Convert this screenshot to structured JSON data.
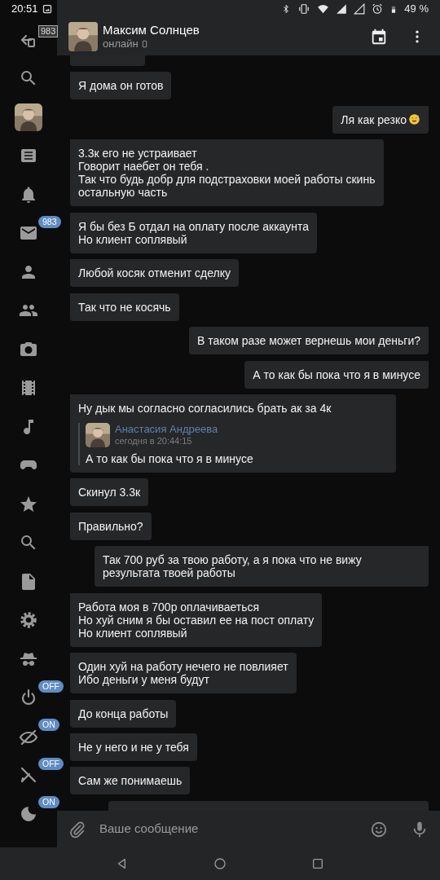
{
  "status_bar": {
    "time": "20:51",
    "battery": "49 %"
  },
  "sidebar": {
    "items": [
      {
        "kind": "back",
        "badge": {
          "text": "983",
          "kind": "box"
        }
      },
      {
        "kind": "search"
      },
      {
        "kind": "avatar"
      },
      {
        "kind": "news"
      },
      {
        "kind": "bell"
      },
      {
        "kind": "mail",
        "badge": {
          "text": "983",
          "kind": "pill"
        }
      },
      {
        "kind": "person"
      },
      {
        "kind": "people"
      },
      {
        "kind": "camera"
      },
      {
        "kind": "film"
      },
      {
        "kind": "music"
      },
      {
        "kind": "gamepad"
      },
      {
        "kind": "star"
      },
      {
        "kind": "search"
      },
      {
        "kind": "doc"
      },
      {
        "kind": "gear"
      },
      {
        "kind": "spy"
      },
      {
        "kind": "power",
        "badge": {
          "text": "OFF",
          "kind": "pill"
        }
      },
      {
        "kind": "eye",
        "badge": {
          "text": "ON",
          "kind": "pill"
        }
      },
      {
        "kind": "pen",
        "badge": {
          "text": "OFF",
          "kind": "pill"
        }
      },
      {
        "kind": "moon",
        "badge": {
          "text": "ON",
          "kind": "pill"
        }
      }
    ]
  },
  "header": {
    "name": "Максим Солнцев",
    "status": "онлайн"
  },
  "messages": [
    {
      "outgoing": false,
      "kind": "cut"
    },
    {
      "outgoing": false,
      "text": "Я дома он готов"
    },
    {
      "outgoing": true,
      "text": "Ля как резко",
      "emoji": true
    },
    {
      "outgoing": false,
      "text": "3.3к его не устраивает\nГоворит наебет он тебя .\nТак что будь добр для подстраховки моей работы скинь остальную часть"
    },
    {
      "outgoing": false,
      "text": "Я бы без Б отдал на оплату после аккаунта\nНо клиент соплявый"
    },
    {
      "outgoing": false,
      "text": "Любой косяк отменит сделку"
    },
    {
      "outgoing": false,
      "text": "Так что не косячь"
    },
    {
      "outgoing": true,
      "text": "В таком разе может вернешь мои деньги?"
    },
    {
      "outgoing": true,
      "text": "А то как бы пока что я в минусе"
    },
    {
      "outgoing": false,
      "text": "Ну дык мы согласно согласились брать ак за 4к",
      "quote": {
        "author": "Анастасия Андреева",
        "time": "сегодня в 20:44:15",
        "text": "А то как бы пока что я в минусе"
      }
    },
    {
      "outgoing": false,
      "text": "Скинул 3.3к"
    },
    {
      "outgoing": false,
      "text": "Правильно?"
    },
    {
      "outgoing": true,
      "text": "Так 700 руб за твою работу, а я пока что не вижу результата твоей работы"
    },
    {
      "outgoing": false,
      "text": "Работа моя в 700р оплачиваеться\nНо хуй сним я бы оставил ее на пост оплату\nНо клиент соплявый"
    },
    {
      "outgoing": false,
      "text": "Один хуй на работу нечего не повлияет\nИбо деньги у меня будут"
    },
    {
      "outgoing": false,
      "text": "До конца работы"
    },
    {
      "outgoing": false,
      "text": "Не у него и не у тебя"
    },
    {
      "outgoing": false,
      "text": "Сам же понимаешь"
    },
    {
      "outgoing": true,
      "kind": "cut"
    }
  ],
  "composer": {
    "placeholder": "Ваше сообщение"
  }
}
